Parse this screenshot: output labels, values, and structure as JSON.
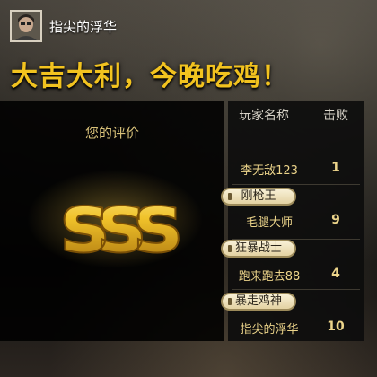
{
  "header": {
    "username": "指尖的浮华",
    "slogan": "大吉大利，今晚吃鸡！"
  },
  "rating": {
    "label": "您的评价",
    "grade": "SSS"
  },
  "scoreboard": {
    "columns": {
      "name": "玩家名称",
      "kills": "击败"
    },
    "players": [
      {
        "name": "李无敌123",
        "kills": "1",
        "title": ""
      },
      {
        "name": "毛腿大师",
        "kills": "9",
        "title": "刚枪王"
      },
      {
        "name": "跑来跑去88",
        "kills": "4",
        "title": "狂暴战士"
      },
      {
        "name": "指尖的浮华",
        "kills": "10",
        "title": "暴走鸡神"
      }
    ]
  },
  "colors": {
    "slogan": "#f2c31f",
    "gold": "#e8b21c",
    "player_text": "#ecd48a",
    "badge_bg": "#f1e6c2"
  },
  "icons": {
    "avatar": "player-avatar-photo"
  }
}
